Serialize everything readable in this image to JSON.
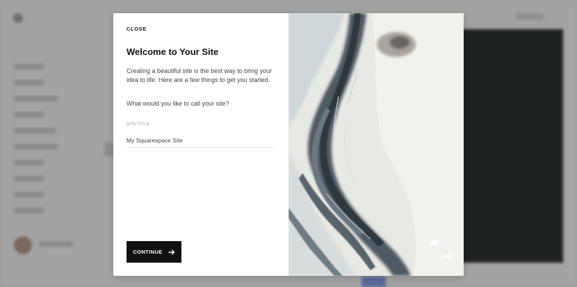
{
  "modal": {
    "close_label": "CLOSE",
    "title": "Welcome to Your Site",
    "description": "Creating a beautiful site is the best way to bring your idea to life. Here are a few things to get you started.",
    "prompt": "What would you like to call your site?",
    "site_title": {
      "label": "SITE TITLE",
      "value": "My Squarespace Site"
    },
    "continue_label": "CONTINUE",
    "continue_icon": "arrow-right-icon",
    "image": "marble-artwork-image"
  },
  "colors": {
    "button_bg": "#111111",
    "overlay": "#a3a3a3",
    "modal_bg": "#ffffff"
  }
}
